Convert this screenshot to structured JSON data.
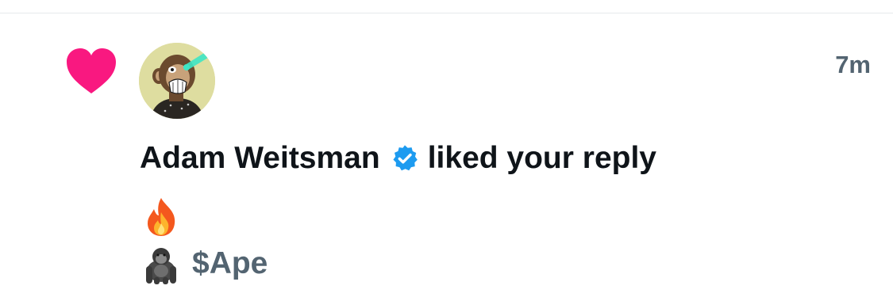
{
  "notification": {
    "type_icon": "heart-icon",
    "avatar_icon": "ape-avatar",
    "timestamp": "7m",
    "user_name": "Adam Weitsman",
    "verified_icon": "verified-badge-icon",
    "action_text": "liked your reply",
    "reply": {
      "line1_emoji": "fire-emoji",
      "line2_emoji": "gorilla-emoji",
      "cashtag": "$Ape"
    }
  },
  "colors": {
    "heart": "#f91880",
    "verified": "#1d9bf0",
    "text_primary": "#0f1419",
    "text_secondary": "#536471",
    "divider": "#e6e9ec"
  }
}
